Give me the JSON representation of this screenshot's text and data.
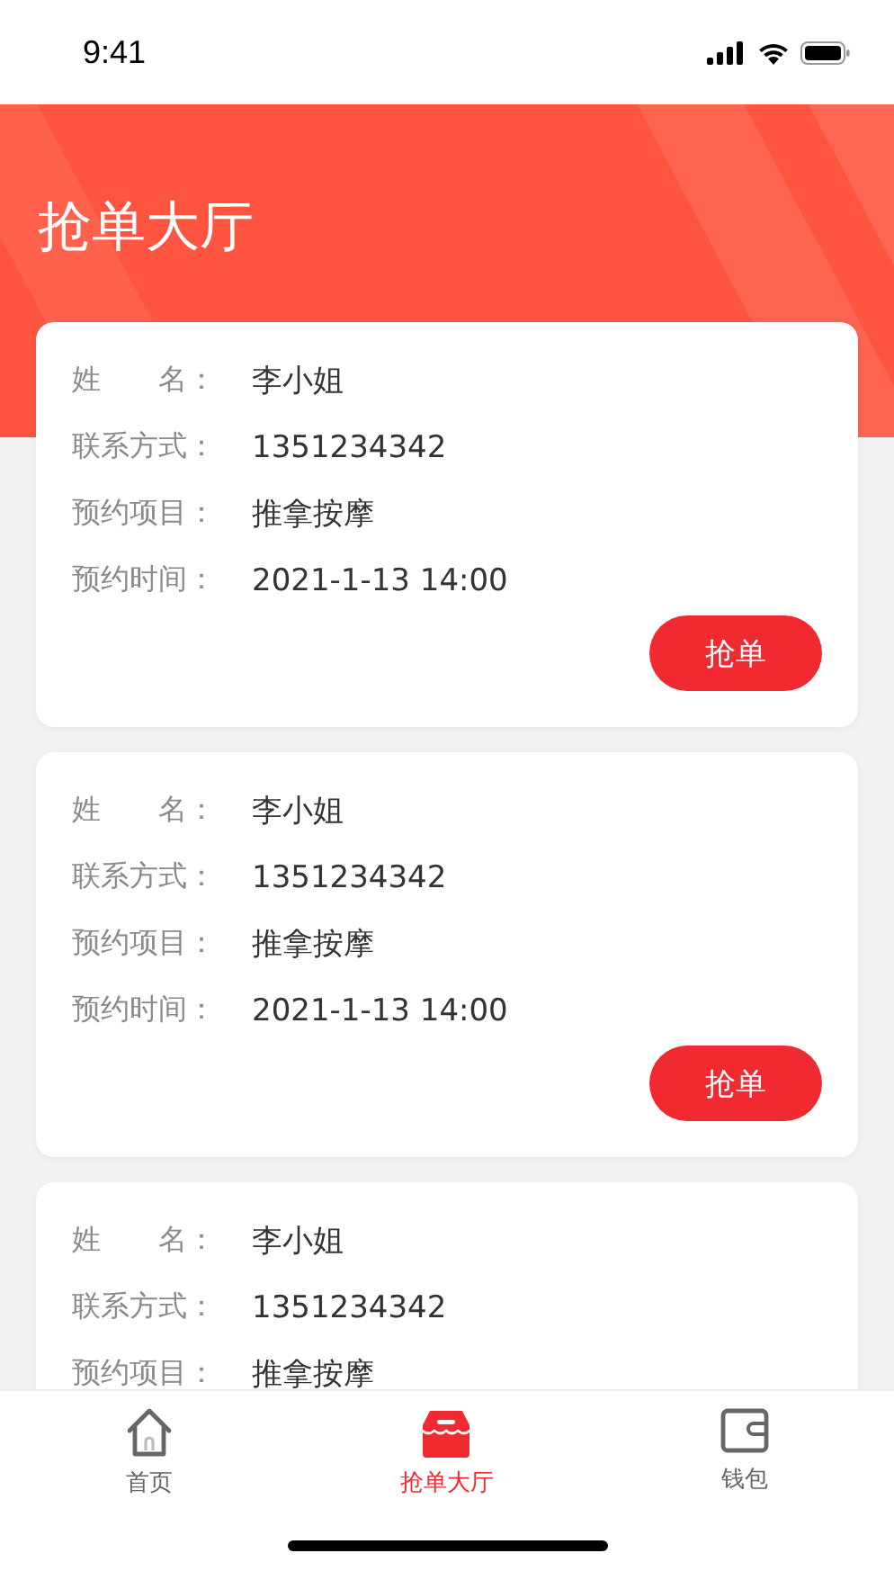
{
  "status_bar": {
    "time": "9:41"
  },
  "header": {
    "title": "抢单大厅"
  },
  "orders": [
    {
      "fields": [
        {
          "label": "姓　　名：",
          "value": "李小姐"
        },
        {
          "label": "联系方式：",
          "value": "1351234342"
        },
        {
          "label": "预约项目：",
          "value": "推拿按摩"
        },
        {
          "label": "预约时间：",
          "value": "2021-1-13 14:00"
        }
      ],
      "button": "抢单"
    },
    {
      "fields": [
        {
          "label": "姓　　名：",
          "value": "李小姐"
        },
        {
          "label": "联系方式：",
          "value": "1351234342"
        },
        {
          "label": "预约项目：",
          "value": "推拿按摩"
        },
        {
          "label": "预约时间：",
          "value": "2021-1-13 14:00"
        }
      ],
      "button": "抢单"
    },
    {
      "fields": [
        {
          "label": "姓　　名：",
          "value": "李小姐"
        },
        {
          "label": "联系方式：",
          "value": "1351234342"
        },
        {
          "label": "预约项目：",
          "value": "推拿按摩"
        }
      ]
    }
  ],
  "tab_bar": [
    {
      "label": "首页",
      "selected": false
    },
    {
      "label": "抢单大厅",
      "selected": true
    },
    {
      "label": "钱包",
      "selected": false
    }
  ]
}
